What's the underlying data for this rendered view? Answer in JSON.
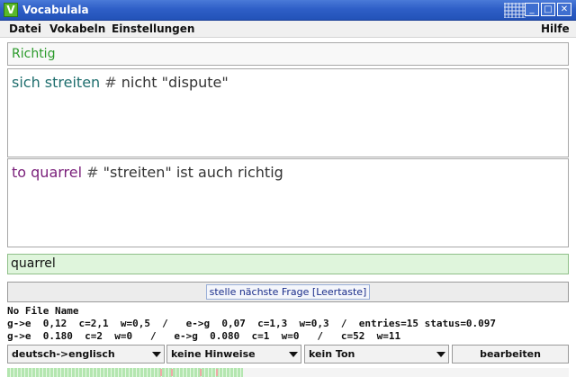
{
  "window": {
    "title": "Vocabulala",
    "icon_letter": "V"
  },
  "window_buttons": {
    "minimize": "_",
    "maximize": "□",
    "close": "✕"
  },
  "menu": {
    "file": "Datei",
    "vocab": "Vokabeln",
    "settings": "Einstellungen",
    "help": "Hilfe"
  },
  "status": {
    "text": "Richtig",
    "color": "#2a9a2a"
  },
  "question": {
    "word": "sich streiten",
    "hash": "#",
    "note": "nicht \"dispute\""
  },
  "answer": {
    "word": "to quarrel",
    "hash": "#",
    "note": "\"streiten\" ist auch richtig"
  },
  "input": {
    "value": "quarrel"
  },
  "next_button": {
    "label": "stelle nächste Frage  [Leertaste]"
  },
  "stats": {
    "file": "No File Name",
    "line1": "g->e  0,12  c=2,1  w=0,5  /   e->g  0,07  c=1,3  w=0,3  /  entries=15 status=0.097",
    "line2": "g->e  0.180  c=2  w=0   /   e->g  0.080  c=1  w=0   /   c=52  w=11"
  },
  "controls": {
    "direction": "deutsch->englisch",
    "hints": "keine Hinweise",
    "sound": "kein Ton",
    "edit": "bearbeiten"
  },
  "progress": {
    "fraction": 0.42
  },
  "colors": {
    "question": "#1f6e6e",
    "answer": "#7a1f7a",
    "title_bar": "#2f5fc7"
  }
}
